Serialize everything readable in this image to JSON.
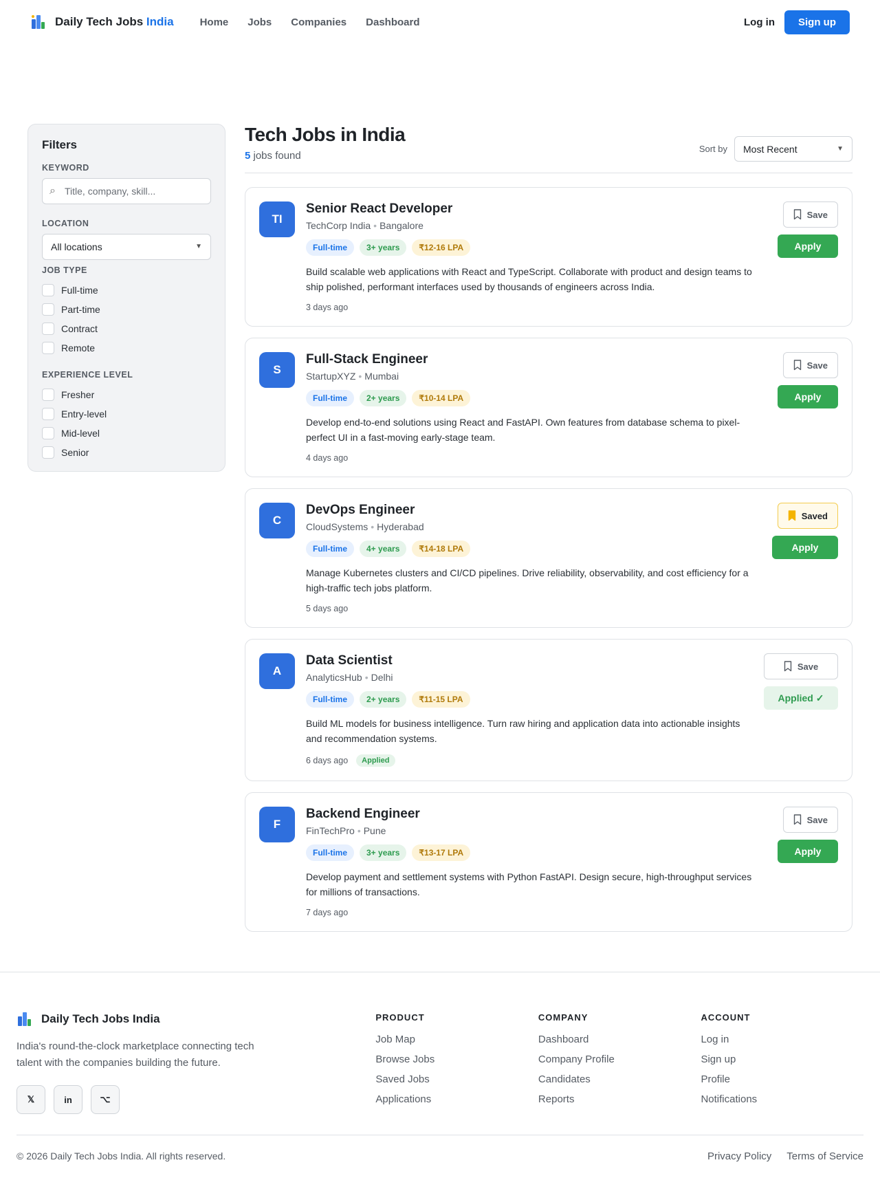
{
  "header": {
    "brand": "Daily Tech Jobs ",
    "brand_accent": "India",
    "nav": [
      "Home",
      "Jobs",
      "Companies",
      "Dashboard"
    ],
    "login": "Log in",
    "signup": "Sign up"
  },
  "filters": {
    "title": "Filters",
    "keyword_label": "KEYWORD",
    "keyword_placeholder": "Title, company, skill...",
    "location_label": "LOCATION",
    "location_value": "All locations",
    "job_type_label": "JOB TYPE",
    "job_types": [
      "Full-time",
      "Part-time",
      "Contract",
      "Remote"
    ],
    "experience_label": "EXPERIENCE LEVEL",
    "experience_levels": [
      "Fresher",
      "Entry-level",
      "Mid-level",
      "Senior"
    ]
  },
  "results": {
    "title": "Tech Jobs in India",
    "count": "5",
    "count_suffix": " jobs found",
    "sort_label": "Sort by",
    "sort_value": "Most Recent"
  },
  "jobs": [
    {
      "initials": "TI",
      "title": "Senior React Developer",
      "company": "TechCorp India",
      "location": "Bangalore",
      "type": "Full-time",
      "experience": "3+ years",
      "salary": "₹12-16 LPA",
      "description": "Build scalable web applications with React and TypeScript. Collaborate with product and design teams to ship polished, performant interfaces used by thousands of engineers across India.",
      "posted": "3 days ago",
      "save_label": "Save",
      "action_label": "Apply"
    },
    {
      "initials": "S",
      "title": "Full-Stack Engineer",
      "company": "StartupXYZ",
      "location": "Mumbai",
      "type": "Full-time",
      "experience": "2+ years",
      "salary": "₹10-14 LPA",
      "description": "Develop end-to-end solutions using React and FastAPI. Own features from database schema to pixel-perfect UI in a fast-moving early-stage team.",
      "posted": "4 days ago",
      "save_label": "Save",
      "action_label": "Apply"
    },
    {
      "initials": "C",
      "title": "DevOps Engineer",
      "company": "CloudSystems",
      "location": "Hyderabad",
      "type": "Full-time",
      "experience": "4+ years",
      "salary": "₹14-18 LPA",
      "description": "Manage Kubernetes clusters and CI/CD pipelines. Drive reliability, observability, and cost efficiency for a high-traffic tech jobs platform.",
      "posted": "5 days ago",
      "save_label": "Saved",
      "action_label": "Apply"
    },
    {
      "initials": "A",
      "title": "Data Scientist",
      "company": "AnalyticsHub",
      "location": "Delhi",
      "type": "Full-time",
      "experience": "2+ years",
      "salary": "₹11-15 LPA",
      "description": "Build ML models for business intelligence. Turn raw hiring and application data into actionable insights and recommendation systems.",
      "posted": "6 days ago",
      "applied_badge": "Applied",
      "save_label": "Save",
      "action_label": "Applied ✓"
    },
    {
      "initials": "F",
      "title": "Backend Engineer",
      "company": "FinTechPro",
      "location": "Pune",
      "type": "Full-time",
      "experience": "3+ years",
      "salary": "₹13-17 LPA",
      "description": "Develop payment and settlement systems with Python FastAPI. Design secure, high-throughput services for millions of transactions.",
      "posted": "7 days ago",
      "save_label": "Save",
      "action_label": "Apply"
    }
  ],
  "footer": {
    "brand": "Daily Tech Jobs India",
    "tagline": "India's round-the-clock marketplace connecting tech talent with the companies building the future.",
    "social": [
      "𝕏",
      "in",
      "⌥"
    ],
    "product_title": "PRODUCT",
    "product_links": [
      "Job Map",
      "Browse Jobs",
      "Saved Jobs",
      "Applications"
    ],
    "company_title": "COMPANY",
    "company_links": [
      "Dashboard",
      "Company Profile",
      "Candidates",
      "Reports"
    ],
    "account_title": "ACCOUNT",
    "account_links": [
      "Log in",
      "Sign up",
      "Profile",
      "Notifications"
    ],
    "copyright": "© 2026 Daily Tech Jobs India. All rights reserved.",
    "privacy": "Privacy Policy",
    "terms": "Terms of Service"
  },
  "colors": {
    "primary": "#1a73e8",
    "apply": "#34a853",
    "avatar": "#2f6fdd",
    "saved_icon": "#f4b400"
  }
}
